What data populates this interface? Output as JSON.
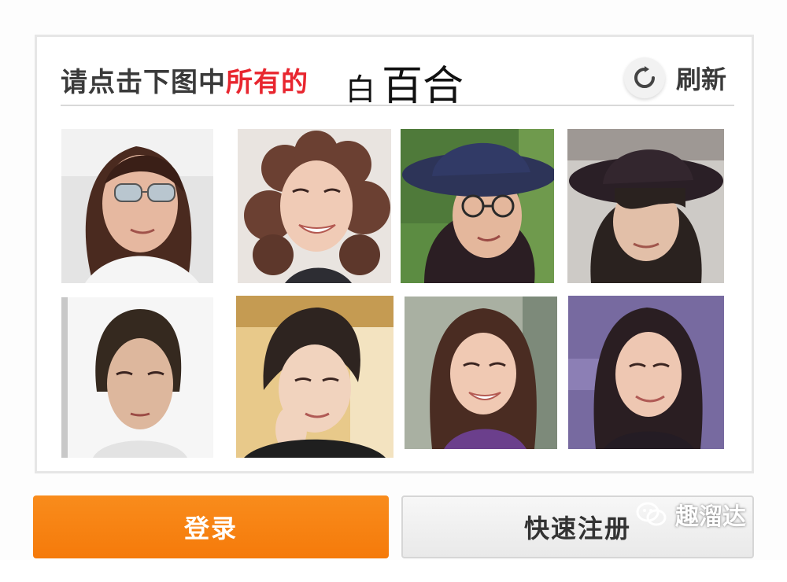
{
  "captcha": {
    "instruction_prefix": "请点击下图中",
    "instruction_highlight": "所有的",
    "target_small": "白",
    "target_big": "百合",
    "refresh_label": "刷新",
    "highlight_color": "#e8262f"
  },
  "images": [
    {
      "name": "photo-woman-sunglasses",
      "icon": "portrait"
    },
    {
      "name": "photo-woman-curly-hair",
      "icon": "portrait"
    },
    {
      "name": "photo-woman-hat-glasses",
      "icon": "portrait"
    },
    {
      "name": "photo-woman-dark-hat",
      "icon": "portrait"
    },
    {
      "name": "photo-woman-white-background",
      "icon": "portrait"
    },
    {
      "name": "photo-woman-hand-on-chin",
      "icon": "portrait"
    },
    {
      "name": "photo-woman-long-hair-smiling",
      "icon": "portrait"
    },
    {
      "name": "photo-woman-purple-background",
      "icon": "portrait"
    }
  ],
  "actions": {
    "login_label": "登录",
    "register_label": "快速注册",
    "login_color": "#f57a0a"
  },
  "watermark": {
    "text": "趣溜达",
    "icon": "wechat-icon"
  }
}
